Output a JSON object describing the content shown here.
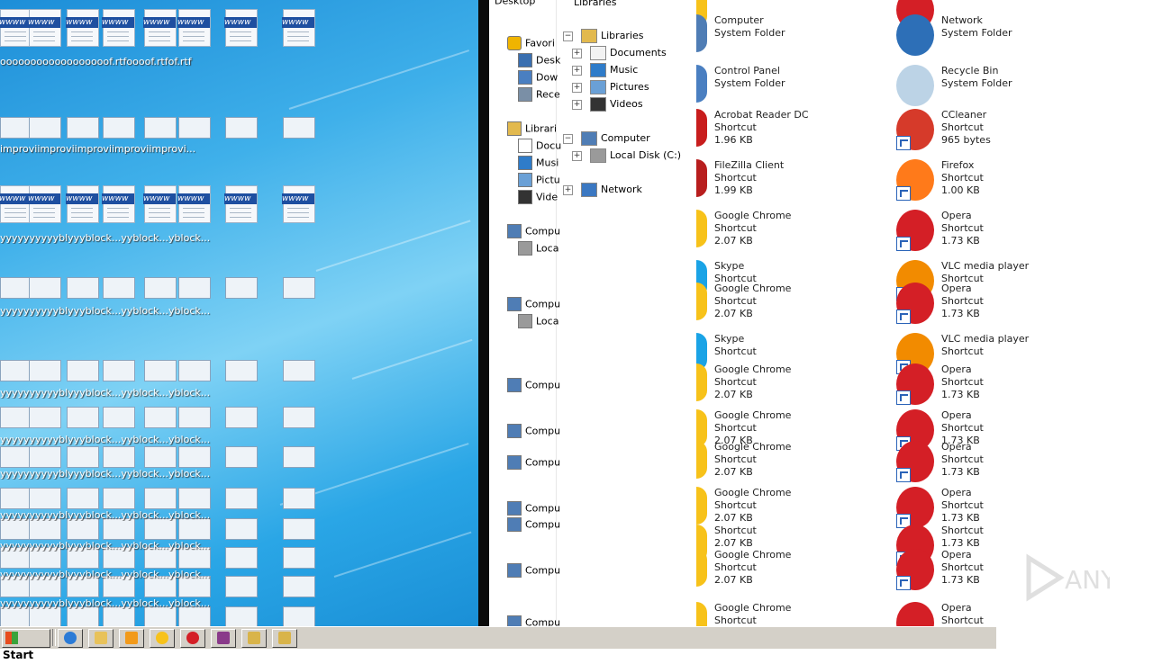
{
  "desktop": {
    "row_labels": [
      {
        "texts": [
          "ooooo",
          "ooooo",
          "ooooo",
          "ooof.rtf",
          "oooof.rtf",
          "of.rtf"
        ]
      },
      {
        "texts": [
          "improvi",
          "improvi",
          "improvi",
          "improvi",
          "improvi..."
        ]
      },
      {
        "texts": [
          "yyyyyyy",
          "yyybly",
          "yyblock...",
          "yyblock...",
          "yblock..."
        ]
      },
      {
        "texts": [
          "yyyyyyy",
          "yyybly",
          "yyblock...",
          "yyblock...",
          "yblock..."
        ]
      }
    ]
  },
  "nav_narrow": {
    "top_text": "Desktop",
    "items": [
      {
        "label": "Favori",
        "icon": "star-icon"
      },
      {
        "label": "Desk",
        "icon": "desktop-icon"
      },
      {
        "label": "Dow",
        "icon": "downloads-icon"
      },
      {
        "label": "Rece",
        "icon": "recent-icon"
      },
      {
        "label": "Librari",
        "icon": "libraries-icon"
      },
      {
        "label": "Docu",
        "icon": "documents-icon"
      },
      {
        "label": "Musi",
        "icon": "music-icon"
      },
      {
        "label": "Pictu",
        "icon": "pictures-icon"
      },
      {
        "label": "Vide",
        "icon": "videos-icon"
      },
      {
        "label": "Compu",
        "icon": "computer-icon"
      },
      {
        "label": "Loca",
        "icon": "drive-icon"
      },
      {
        "label": "Compu",
        "icon": "computer-icon"
      },
      {
        "label": "Loca",
        "icon": "drive-icon"
      },
      {
        "label": "Compu",
        "icon": "computer-icon"
      },
      {
        "label": "Compu",
        "icon": "computer-icon"
      },
      {
        "label": "Compu",
        "icon": "computer-icon"
      },
      {
        "label": "Compu",
        "icon": "computer-icon"
      },
      {
        "label": "Compu",
        "icon": "computer-icon"
      },
      {
        "label": "Compu",
        "icon": "computer-icon"
      },
      {
        "label": "Compu",
        "icon": "computer-icon"
      }
    ]
  },
  "tree": {
    "top_label": "Libraries",
    "items": [
      {
        "label": "Libraries",
        "expander": "−"
      },
      {
        "label": "Documents",
        "expander": "+"
      },
      {
        "label": "Music",
        "expander": "+"
      },
      {
        "label": "Pictures",
        "expander": "+"
      },
      {
        "label": "Videos",
        "expander": "+"
      },
      {
        "label": "Computer",
        "expander": "−"
      },
      {
        "label": "Local Disk (C:)",
        "expander": "+"
      },
      {
        "label": "Network",
        "expander": "+"
      }
    ]
  },
  "content": {
    "left": [
      {
        "name": "",
        "type": "System Folder",
        "size": ""
      },
      {
        "name": "Computer",
        "type": "System Folder",
        "size": ""
      },
      {
        "name": "Control Panel",
        "type": "System Folder",
        "size": ""
      },
      {
        "name": "Acrobat Reader DC",
        "type": "Shortcut",
        "size": "1.96 KB"
      },
      {
        "name": "FileZilla Client",
        "type": "Shortcut",
        "size": "1.99 KB"
      },
      {
        "name": "Google Chrome",
        "type": "Shortcut",
        "size": "2.07 KB"
      },
      {
        "name": "Skype",
        "type": "Shortcut",
        "size": ""
      },
      {
        "name": "Google Chrome",
        "type": "Shortcut",
        "size": "2.07 KB"
      },
      {
        "name": "Skype",
        "type": "Shortcut",
        "size": ""
      },
      {
        "name": "Google Chrome",
        "type": "Shortcut",
        "size": "2.07 KB"
      },
      {
        "name": "Google Chrome",
        "type": "Shortcut",
        "size": "2.07 KB"
      },
      {
        "name": "Google Chrome",
        "type": "Shortcut",
        "size": "2.07 KB"
      },
      {
        "name": "Google Chrome",
        "type": "Shortcut",
        "size": "2.07 KB"
      },
      {
        "name": "",
        "type": "Shortcut",
        "size": "2.07 KB"
      },
      {
        "name": "Google Chrome",
        "type": "Shortcut",
        "size": "2.07 KB"
      },
      {
        "name": "Google Chrome",
        "type": "Shortcut",
        "size": ""
      }
    ],
    "right": [
      {
        "name": "System Folder",
        "type": "",
        "size": ""
      },
      {
        "name": "Network",
        "type": "System Folder",
        "size": ""
      },
      {
        "name": "Recycle Bin",
        "type": "System Folder",
        "size": ""
      },
      {
        "name": "CCleaner",
        "type": "Shortcut",
        "size": "965 bytes"
      },
      {
        "name": "Firefox",
        "type": "Shortcut",
        "size": "1.00 KB"
      },
      {
        "name": "Opera",
        "type": "Shortcut",
        "size": "1.73 KB"
      },
      {
        "name": "VLC media player",
        "type": "Shortcut",
        "size": ""
      },
      {
        "name": "Opera",
        "type": "Shortcut",
        "size": "1.73 KB"
      },
      {
        "name": "VLC media player",
        "type": "Shortcut",
        "size": ""
      },
      {
        "name": "Opera",
        "type": "Shortcut",
        "size": "1.73 KB"
      },
      {
        "name": "Opera",
        "type": "Shortcut",
        "size": "1.73 KB"
      },
      {
        "name": "Opera",
        "type": "Shortcut",
        "size": "1.73 KB"
      },
      {
        "name": "Opera",
        "type": "Shortcut",
        "size": "1.73 KB"
      },
      {
        "name": "",
        "type": "Shortcut",
        "size": "1.73 KB"
      },
      {
        "name": "Opera",
        "type": "Shortcut",
        "size": "1.73 KB"
      },
      {
        "name": "Opera",
        "type": "Shortcut",
        "size": ""
      }
    ]
  },
  "taskbar": {
    "start_label": "Start",
    "buttons": [
      "ie-icon",
      "explorer-icon",
      "media-player-icon",
      "chrome-icon",
      "opera-icon",
      "winrar-icon",
      "program-icon",
      "program-icon"
    ]
  },
  "watermark": {
    "text": "ANY.RUN"
  },
  "colors": {
    "desktop_accent": "#2aa6e6",
    "taskbar": "#d4d0c8",
    "opera_red": "#d41f26",
    "chrome_yellow": "#f7c21a"
  }
}
